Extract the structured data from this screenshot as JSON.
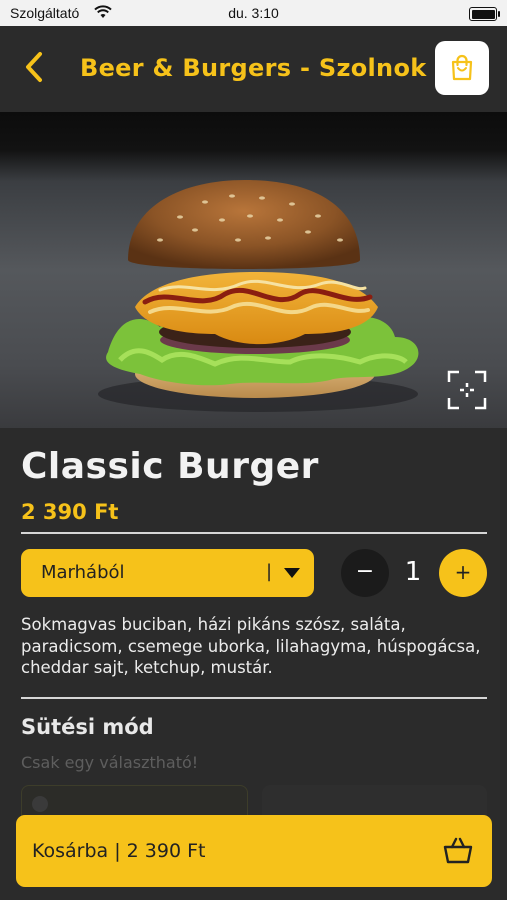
{
  "status_bar": {
    "carrier": "Szolgáltató",
    "time": "du. 3:10"
  },
  "nav": {
    "title": "Beer & Burgers - Szolnok"
  },
  "product": {
    "name": "Classic Burger",
    "price": "2 390 Ft",
    "meat_select": {
      "value": "Marhából",
      "separator": "|"
    },
    "quantity": {
      "value": "1",
      "minus": "−",
      "plus": "+"
    },
    "description": "Sokmagvas buciban, házi pikáns szósz, saláta, paradicsom, csemege uborka, lilahagyma, húspogácsa, cheddar sajt, ketchup, mustár."
  },
  "cooking": {
    "title": "Sütési mód",
    "hint": "Csak egy választható!",
    "options": [
      "",
      ""
    ]
  },
  "cta": {
    "label": "Kosárba | 2 390 Ft"
  },
  "colors": {
    "accent": "#f6c21a",
    "background": "#2b2b2b"
  },
  "icons": [
    "back-chevron-icon",
    "shopping-bag-icon",
    "expand-icon",
    "caret-down-icon",
    "basket-icon",
    "wifi-icon",
    "battery-icon"
  ]
}
